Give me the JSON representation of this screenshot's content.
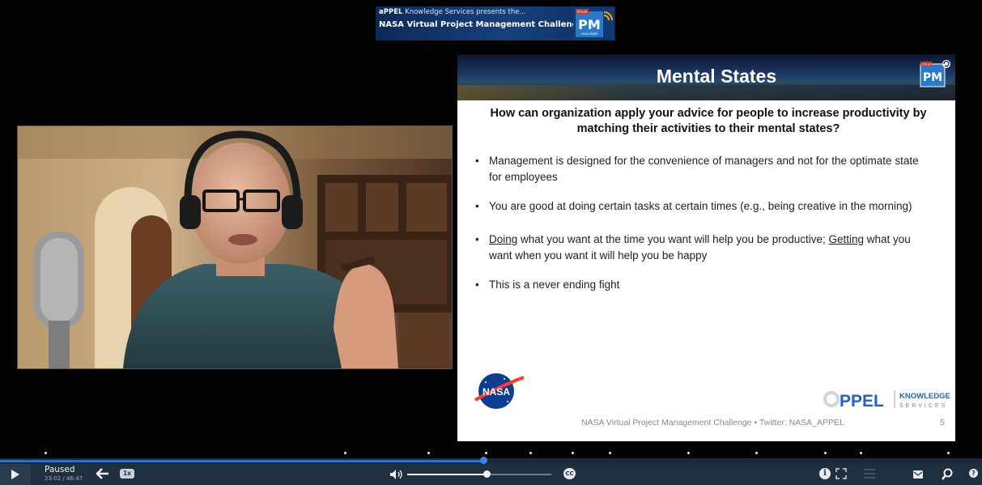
{
  "banner": {
    "line1_brand": "PPEL",
    "line1_rest": " Knowledge Services presents the...",
    "line2": "NASA Virtual Project Management Challenge",
    "logo_small": "Virtual",
    "logo_big": "PM",
    "logo_sub": "CHALLENGE"
  },
  "slide": {
    "title": "Mental States",
    "logo_small": "Virtual",
    "logo_big": "PM",
    "question": "How can organization apply your advice for people to increase productivity by matching their activities to their mental states?",
    "bullets": [
      {
        "text": "Management is designed for the convenience of managers and not for the optimate state for employees"
      },
      {
        "text": "You are good at doing certain tasks at certain times (e.g., being creative in the morning)"
      },
      {
        "u1": "Doing",
        "t1": " what you want at the time you want will help you be productive; ",
        "u2": "Getting",
        "t2": " what you want when you want it will help you be happy"
      },
      {
        "text": "This is a never ending fight"
      }
    ],
    "nasa_logo_text": "NASA",
    "appel_logo_text": "PPEL",
    "appel_knowledge": "KNOWLEDGE",
    "appel_services": "SERVICES",
    "footer": "NASA Virtual Project Management Challenge • Twitter: NASA_APPEL",
    "page_number": "5"
  },
  "player": {
    "status": "Paused",
    "time": "23:02 / 46:47",
    "speed": "1x",
    "cc": "CC",
    "info": "i",
    "help": "?",
    "progress_fraction": 0.492,
    "volume_fraction": 0.55,
    "chapter_markers_fraction": [
      0.046,
      0.351,
      0.436,
      0.495,
      0.54,
      0.583,
      0.621,
      0.701,
      0.77,
      0.84,
      0.876,
      0.965
    ]
  },
  "colors": {
    "controls_bg": "#1e2f40",
    "progress": "#2d6fc0"
  },
  "icons": {
    "play": "play-icon",
    "back": "back-arrow-icon",
    "volume": "volume-icon",
    "fullscreen": "fullscreen-icon",
    "menu": "menu-icon",
    "chat": "chat-icon",
    "search": "search-icon"
  }
}
